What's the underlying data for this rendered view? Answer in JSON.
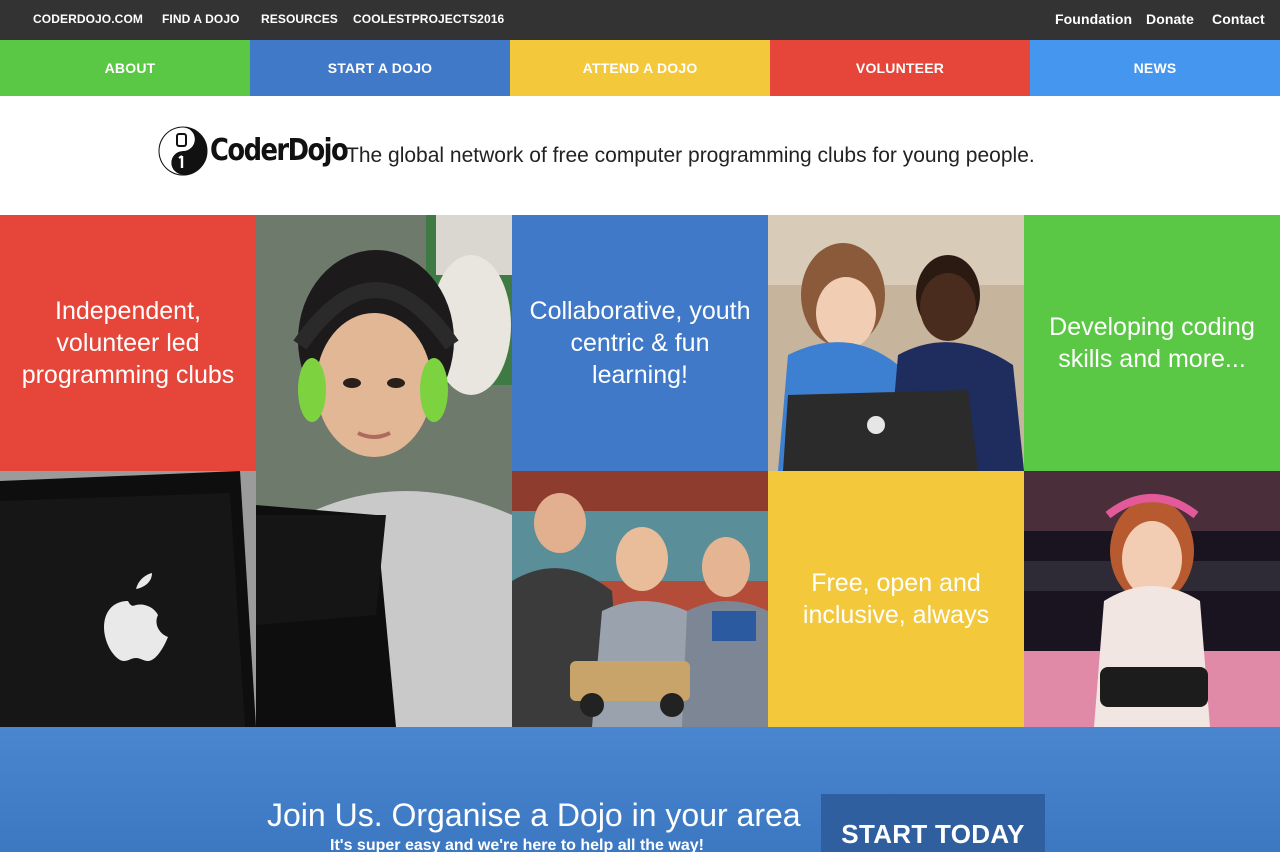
{
  "topbar": {
    "left_links": [
      "CODERDOJO.COM",
      "FIND A DOJO",
      "RESOURCES",
      "COOLESTPROJECTS2016"
    ],
    "right_links": [
      "Foundation",
      "Donate",
      "Contact"
    ]
  },
  "mainnav": {
    "tabs": [
      {
        "label": "ABOUT",
        "color": "#5bc845"
      },
      {
        "label": "START A DOJO",
        "color": "#3f79c8"
      },
      {
        "label": "ATTEND A DOJO",
        "color": "#f3c93b"
      },
      {
        "label": "VOLUNTEER",
        "color": "#e6463a"
      },
      {
        "label": "NEWS",
        "color": "#4596ee"
      }
    ]
  },
  "brand": {
    "logo_text": "CoderDojo",
    "tagline": "The global network of free computer programming clubs for young people."
  },
  "tiles": [
    {
      "text": "Independent,\nvolunteer led\nprogramming clubs",
      "color": "#e6463a"
    },
    {
      "text": "Collaborative, youth\ncentric & fun\nlearning!",
      "color": "#3f79c8"
    },
    {
      "text": "Developing coding\nskills and more...",
      "color": "#5bc845"
    },
    {
      "text": "Free, open and\ninclusive, always",
      "color": "#f3c93b"
    }
  ],
  "cta": {
    "headline": "Join Us. Organise a Dojo in your area",
    "subtext": "It's super easy and we're here to help all the way!",
    "button_label": "START TODAY"
  },
  "colors": {
    "topbar": "#333333",
    "cta_band": "#4580c9",
    "cta_button": "#2f5f9e"
  }
}
